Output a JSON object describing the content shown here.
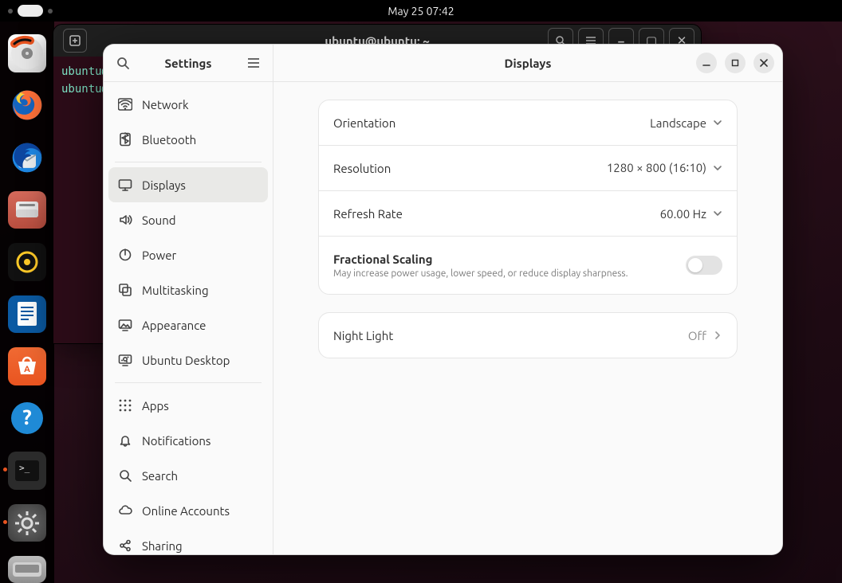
{
  "panel": {
    "clock": "May 25  07:42"
  },
  "terminal": {
    "title": "ubuntu@ubuntu: ~",
    "lines": [
      "ubuntu@",
      "ubuntu@"
    ]
  },
  "settings": {
    "sidebar": {
      "title": "Settings",
      "groups": [
        [
          {
            "id": "network",
            "label": "Network",
            "icon": "wifi-icon"
          },
          {
            "id": "bluetooth",
            "label": "Bluetooth",
            "icon": "bluetooth-icon"
          }
        ],
        [
          {
            "id": "displays",
            "label": "Displays",
            "icon": "display-icon",
            "selected": true
          },
          {
            "id": "sound",
            "label": "Sound",
            "icon": "speaker-icon"
          },
          {
            "id": "power",
            "label": "Power",
            "icon": "power-icon"
          },
          {
            "id": "multitask",
            "label": "Multitasking",
            "icon": "multitasking-icon"
          },
          {
            "id": "appearance",
            "label": "Appearance",
            "icon": "appearance-icon"
          },
          {
            "id": "ubuntu",
            "label": "Ubuntu Desktop",
            "icon": "ubuntu-icon"
          }
        ],
        [
          {
            "id": "apps",
            "label": "Apps",
            "icon": "apps-icon"
          },
          {
            "id": "notif",
            "label": "Notifications",
            "icon": "bell-icon"
          },
          {
            "id": "search",
            "label": "Search",
            "icon": "search-icon"
          },
          {
            "id": "online",
            "label": "Online Accounts",
            "icon": "cloud-icon"
          },
          {
            "id": "sharing",
            "label": "Sharing",
            "icon": "share-icon"
          }
        ]
      ]
    },
    "header": {
      "title": "Displays"
    },
    "display": {
      "orientation": {
        "label": "Orientation",
        "value": "Landscape"
      },
      "resolution": {
        "label": "Resolution",
        "value": "1280 × 800 (16∶10)"
      },
      "refresh": {
        "label": "Refresh Rate",
        "value": "60.00 Hz"
      },
      "frac": {
        "label": "Fractional Scaling",
        "sub": "May increase power usage, lower speed, or reduce display sharpness.",
        "on": false
      },
      "night": {
        "label": "Night Light",
        "value": "Off"
      }
    }
  },
  "icons": {
    "wifi-icon": "≋",
    "bluetooth-icon": "ᛒ",
    "display-icon": "▭",
    "speaker-icon": "🔊",
    "power-icon": "⏻",
    "multitasking-icon": "▦",
    "appearance-icon": "◧",
    "ubuntu-icon": "◎",
    "apps-icon": "⋮⋮⋮",
    "bell-icon": "🔔",
    "search-icon": "🔍",
    "cloud-icon": "☁",
    "share-icon": "∝"
  }
}
